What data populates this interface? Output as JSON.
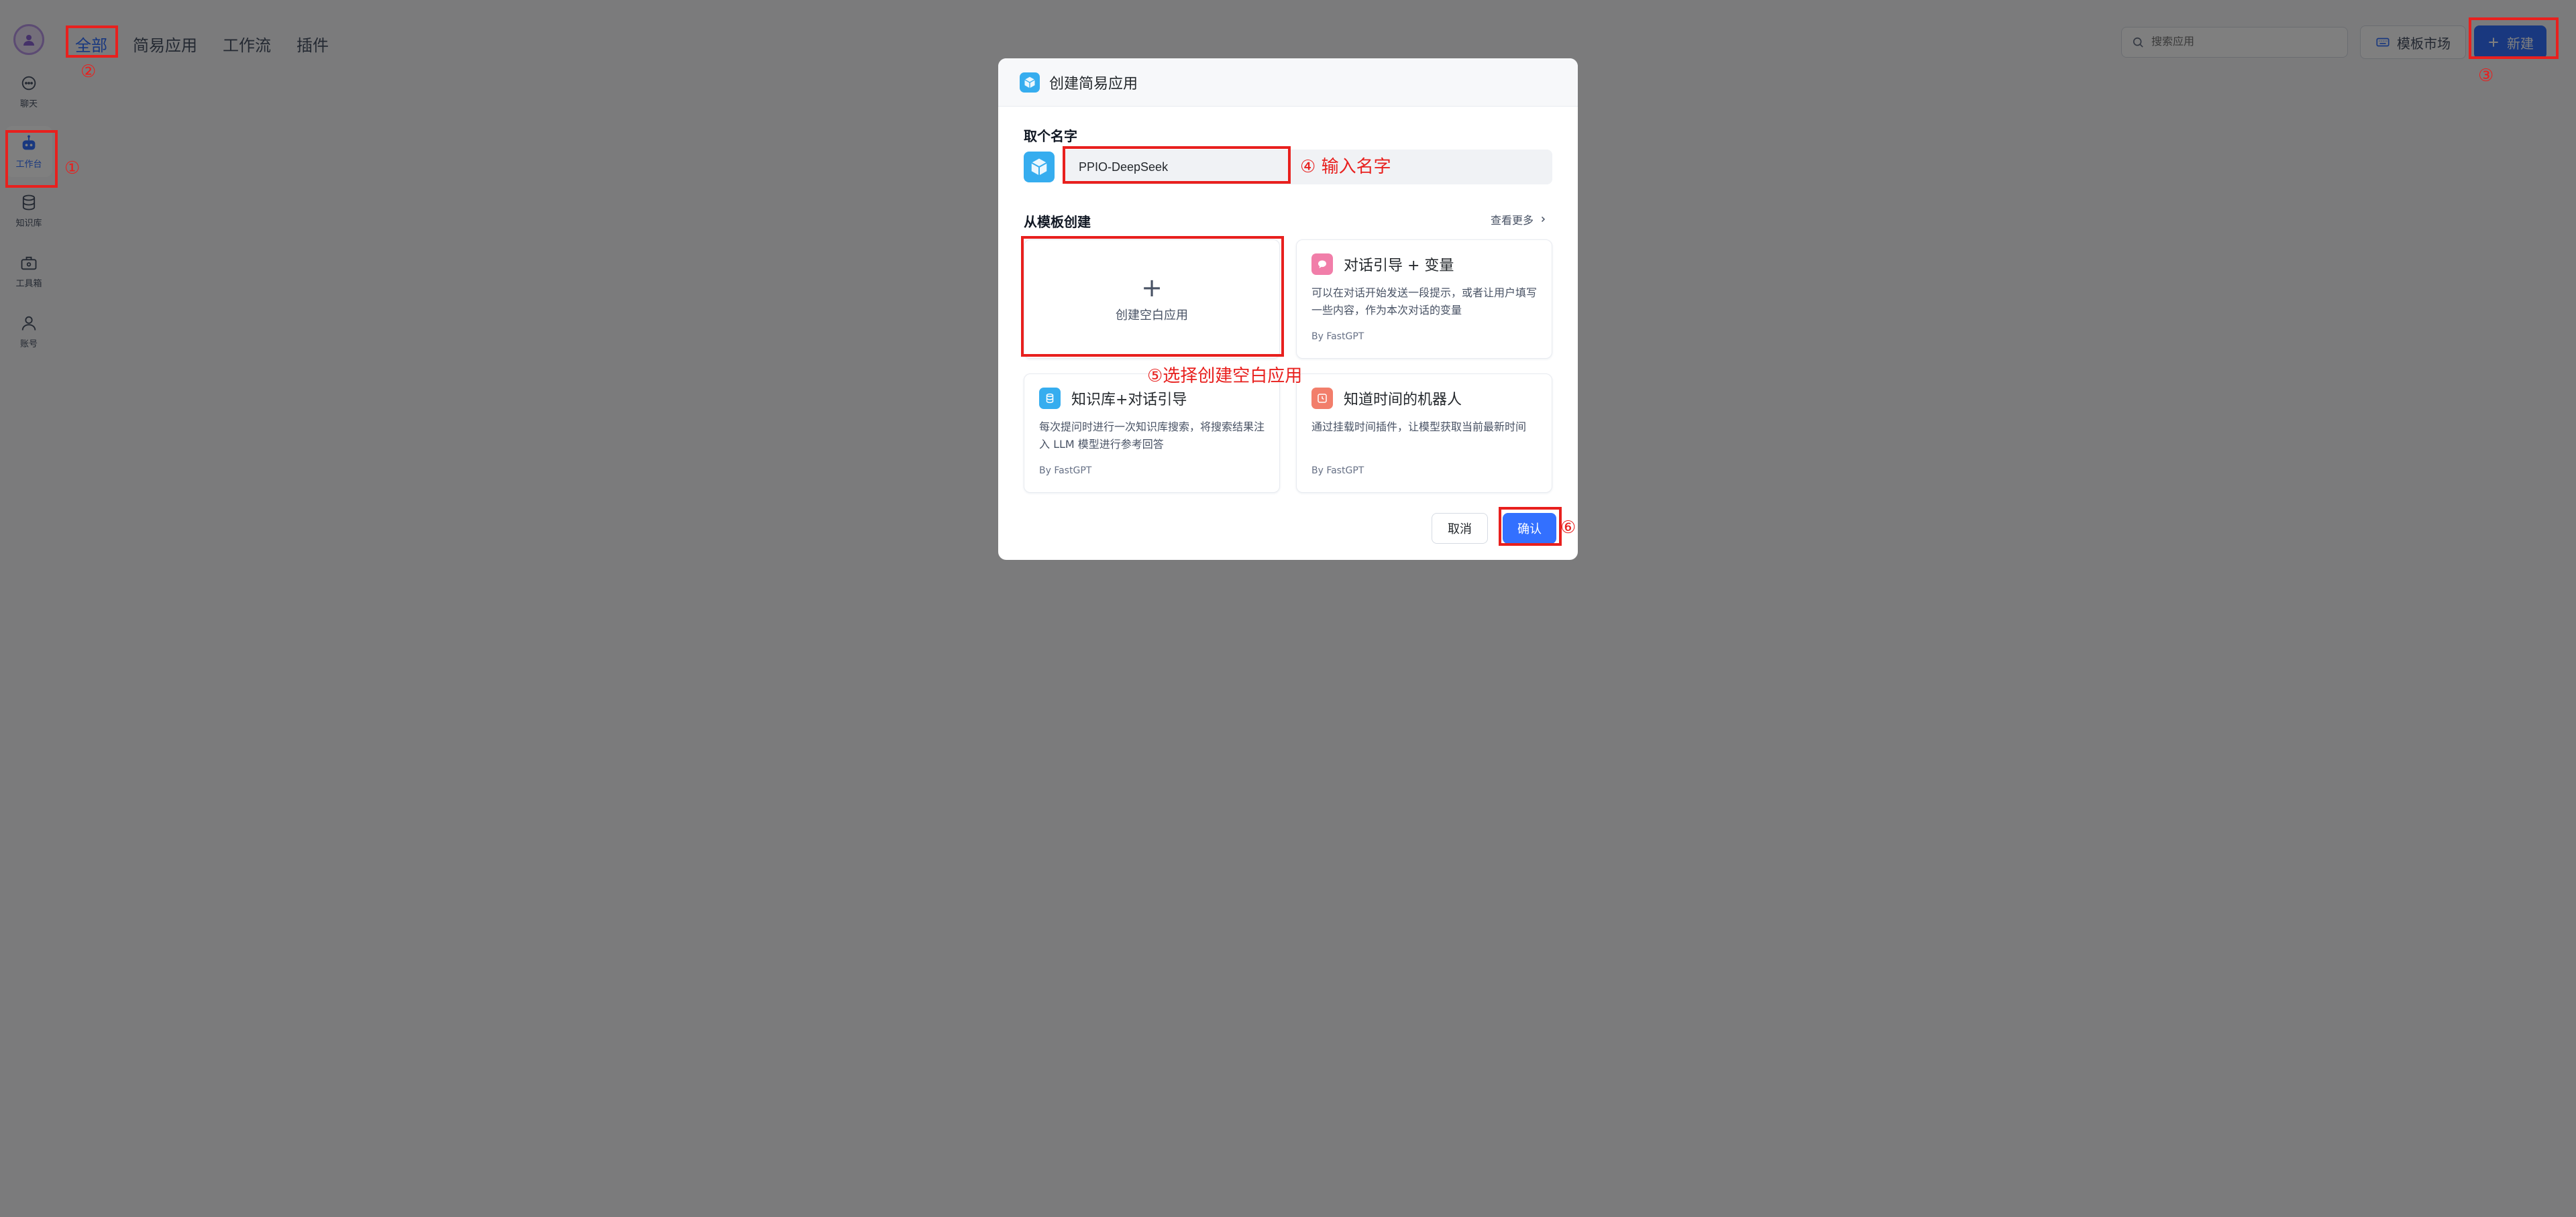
{
  "sidebar": {
    "items": [
      {
        "label": "聊天"
      },
      {
        "label": "工作台"
      },
      {
        "label": "知识库"
      },
      {
        "label": "工具箱"
      },
      {
        "label": "账号"
      }
    ]
  },
  "topnav": {
    "tabs": [
      {
        "label": "全部"
      },
      {
        "label": "简易应用"
      },
      {
        "label": "工作流"
      },
      {
        "label": "插件"
      }
    ]
  },
  "header": {
    "search_placeholder": "搜索应用",
    "market_label": "模板市场",
    "new_label": "新建"
  },
  "modal": {
    "title": "创建简易应用",
    "name_label": "取个名字",
    "name_value": "PPIO-DeepSeek",
    "template_label": "从模板创建",
    "see_more": "查看更多",
    "blank_card_label": "创建空白应用",
    "templates": [
      {
        "title": "对话引导 + 变量",
        "desc": "可以在对话开始发送一段提示，或者让用户填写一些内容，作为本次对话的变量",
        "by": "By FastGPT"
      },
      {
        "title": "知识库+对话引导",
        "desc": "每次提问时进行一次知识库搜索，将搜索结果注入 LLM 模型进行参考回答",
        "by": "By FastGPT"
      },
      {
        "title": "知道时间的机器人",
        "desc": "通过挂载时间插件，让模型获取当前最新时间",
        "by": "By FastGPT"
      }
    ],
    "cancel_label": "取消",
    "confirm_label": "确认"
  },
  "annotations": {
    "step1": "①",
    "step2": "②",
    "step3": "③",
    "step4": "④ 输入名字",
    "step5": "⑤选择创建空白应用",
    "step6": "⑥"
  },
  "colors": {
    "accent": "#3370ff",
    "annotation": "#e8201e",
    "overlay": "rgba(0,0,0,0.5)"
  }
}
